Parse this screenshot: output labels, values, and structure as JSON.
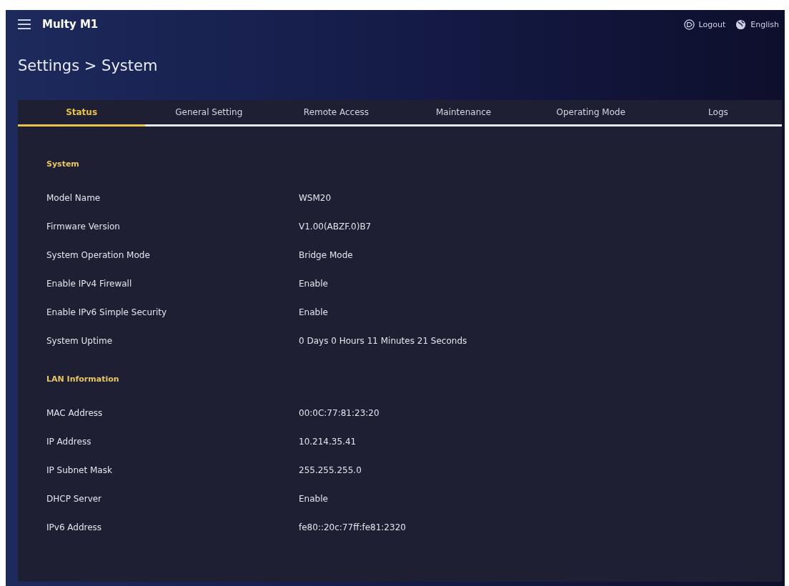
{
  "header": {
    "brand": "Multy M1",
    "logout": "Logout",
    "language": "English"
  },
  "page_title": "Settings > System",
  "tabs": [
    {
      "label": "Status",
      "selected": true
    },
    {
      "label": "General Setting",
      "selected": false
    },
    {
      "label": "Remote Access",
      "selected": false
    },
    {
      "label": "Maintenance",
      "selected": false
    },
    {
      "label": "Operating Mode",
      "selected": false
    },
    {
      "label": "Logs",
      "selected": false
    }
  ],
  "sections": [
    {
      "title": "System",
      "rows": [
        {
          "label": "Model Name",
          "value": "WSM20"
        },
        {
          "label": "Firmware Version",
          "value": "V1.00(ABZF.0)B7"
        },
        {
          "label": "System Operation Mode",
          "value": "Bridge Mode"
        },
        {
          "label": "Enable IPv4 Firewall",
          "value": "Enable"
        },
        {
          "label": "Enable IPv6 Simple Security",
          "value": "Enable"
        },
        {
          "label": "System Uptime",
          "value": "0 Days 0 Hours 11 Minutes 21 Seconds"
        }
      ]
    },
    {
      "title": "LAN Information",
      "rows": [
        {
          "label": "MAC Address",
          "value": "00:0C:77:81:23:20"
        },
        {
          "label": "IP Address",
          "value": "10.214.35.41"
        },
        {
          "label": "IP Subnet Mask",
          "value": "255.255.255.0"
        },
        {
          "label": "DHCP Server",
          "value": "Enable"
        },
        {
          "label": "IPv6 Address",
          "value": "fe80::20c:77ff:fe81:2320"
        }
      ]
    }
  ]
}
